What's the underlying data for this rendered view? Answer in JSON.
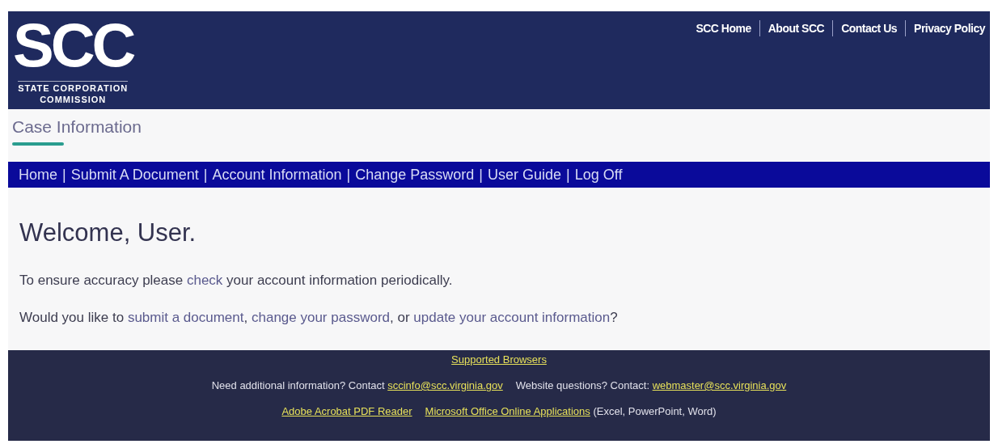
{
  "header": {
    "logo": {
      "mark": "SCC",
      "line_1": "STATE CORPORATION",
      "line_2": "COMMISSION"
    },
    "top_links": [
      "SCC Home",
      "About SCC",
      "Contact Us",
      "Privacy Policy"
    ]
  },
  "page_title": "Case Information",
  "nav": {
    "separator": "|",
    "items": [
      "Home",
      "Submit A Document",
      "Account Information",
      "Change Password",
      "User Guide",
      "Log Off"
    ]
  },
  "welcome": "Welcome, User.",
  "paragraphs": [
    [
      {
        "kind": "text",
        "text": "To ensure accuracy please "
      },
      {
        "kind": "link",
        "text": "check"
      },
      {
        "kind": "text",
        "text": " your account information periodically."
      }
    ],
    [
      {
        "kind": "text",
        "text": "Would you like to "
      },
      {
        "kind": "link",
        "text": "submit a document"
      },
      {
        "kind": "text",
        "text": ", "
      },
      {
        "kind": "link",
        "text": "change your password"
      },
      {
        "kind": "text",
        "text": ", or "
      },
      {
        "kind": "link",
        "text": "update your account information"
      },
      {
        "kind": "text",
        "text": "?"
      }
    ]
  ],
  "footer": {
    "lines": [
      [
        {
          "kind": "link",
          "text": "Supported Browsers"
        }
      ],
      [
        {
          "kind": "text",
          "text": "Need additional information? Contact "
        },
        {
          "kind": "link",
          "text": "sccinfo@scc.virginia.gov"
        },
        {
          "kind": "gap"
        },
        {
          "kind": "text",
          "text": "Website questions? Contact: "
        },
        {
          "kind": "link",
          "text": "webmaster@scc.virginia.gov"
        }
      ],
      [
        {
          "kind": "link",
          "text": "Adobe Acrobat PDF Reader"
        },
        {
          "kind": "gap"
        },
        {
          "kind": "link",
          "text": "Microsoft Office Online Applications"
        },
        {
          "kind": "text",
          "text": " (Excel, PowerPoint, Word)"
        }
      ]
    ]
  }
}
